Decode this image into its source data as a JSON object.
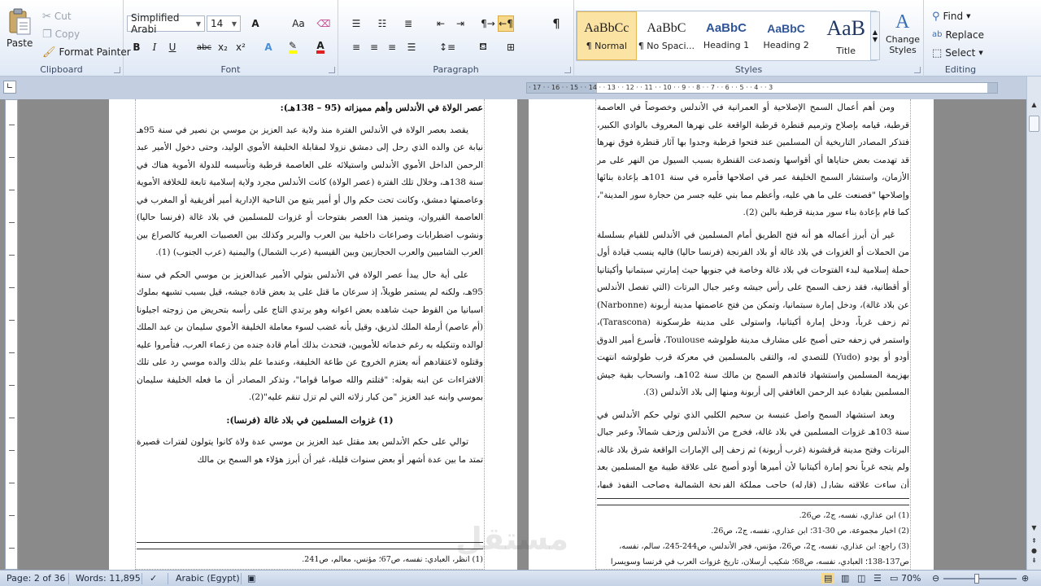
{
  "clipboard": {
    "label": "Clipboard",
    "paste": "Paste",
    "cut": "Cut",
    "copy": "Copy",
    "format_painter": "Format Painter"
  },
  "font": {
    "label": "Font",
    "family": "Simplified Arabi",
    "size": "14",
    "bold": "B",
    "italic": "I",
    "underline": "U",
    "strike": "abc",
    "subscript": "x₂",
    "superscript": "x²",
    "grow": "A",
    "case": "Aa",
    "highlight_color": "#ffff00",
    "font_color": "#e02020"
  },
  "paragraph": {
    "label": "Paragraph",
    "show_marks": "¶"
  },
  "styles": {
    "label": "Styles",
    "items": [
      {
        "sample": "AaBbCc",
        "name": "¶ Normal"
      },
      {
        "sample": "AaBbC",
        "name": "¶ No Spaci..."
      },
      {
        "sample": "AaBbC",
        "name": "Heading 1"
      },
      {
        "sample": "AaBbC",
        "name": "Heading 2"
      },
      {
        "sample": "AaB",
        "name": "Title"
      }
    ],
    "change": "Change Styles"
  },
  "editing": {
    "label": "Editing",
    "find": "Find",
    "replace": "Replace",
    "select": "Select"
  },
  "ruler": {
    "numbers": "· 17 · · 16 · · 15 · · 14 · · 13 · · 12 · · 11 · · 10 · · 9 · · 8 · · 7 · · 6 · · 5 · · 4 · · 3"
  },
  "page_left": {
    "heading": "عصر الولاة في الأندلس وأهم مميزاته (95 – 138هـ):",
    "paragraphs": [
      "يقصد بعصر الولاة في الأندلس الفترة منذ ولاية عبد العزيز بن موسي بن نصير في سنة 95هـ نيابة عن والده الذي رحل إلى دمشق نزولا لمقابلة الخليفة الأموي الوليد، وحتى دخول الأمير عبد الرحمن الداخل الأموي الأندلس واستيلائه على العاصمة قرطبة وتأسيسه للدولة الأموية هناك في سنة 138هـ، وخلال تلك الفترة (عصر الولاة) كانت الأندلس مجرد ولاية إسلامية تابعة للخلافة الأموية وعاصمتها دمشق، وكانت تحت حكم وال أو أمير يتبع من الناحية الإدارية أمير أفريقية أو المغرب في العاصمة القيروان، ويتميز هذا العصر بفتوحات أو غزوات للمسلمين في بلاد غالة (فرنسا حاليا) ونشوب اضطرابات وصراعات داخلية بين العرب والبربر وكذلك بين العصبيات العربية كالصراع بين العرب الشاميين والعرب الحجازيين وبين القيسية (عرب الشمال) واليمنية (عرب الجنوب) (1).",
      "على أية حال يبدأ عصر الولاة في الأندلس بتولي الأمير عبدالعزيز بن موسي الحكم في سنة 95هـ، ولكنه لم يستمر طويلاً، إذ سرعان ما قتل على يد بعض قادة جيشه، قيل بسبب تشبهه بملوك اسبانيا من القوط حيث شاهده بعض اعوانه وهو يرتدي التاج على رأسه بتحريض من زوجته اجيلونا (أم عاصم) أرملة الملك لذريق، وقيل بأنه غضب لسوء معاملة الخليفة الأموي سليمان بن عبد الملك لوالده وتنكيله به رغم خدماته للأمويين، فتحدث بذلك أمام قادة جنده من زعماء العرب، فتأمروا عليه وقتلوه لاعتقادهم أنه يعتزم الخروج عن طاعة الخليفة، وعندما علم بذلك والده موسي رد على تلك الافتراءات عن ابنه بقوله: \"قتلتم والله صواما قواما\"، وتذكر المصادر أن ما فعله الخليفة سليمان بموسي وابنه عبد العزيز \"من كبار زلاته التي لم تزل تنقم عليه\"(2)."
    ],
    "subheading": "(1) غزوات المسلمين في بلاد غالة (فرنسا):",
    "paragraph_end": "توالي على حكم الأندلس بعد مقتل عبد العزيز بن موسي عدة ولاة كانوا يتولون لفترات قصيرة تمتد ما بين عدة أشهر أو بعض سنوات قليلة، غير أن أبرز هؤلاء هو السمح بن مالك",
    "footnote": "(1) انظر، العبادي: نفسه، ص67؛ مؤنس، معالم، ص241."
  },
  "page_right": {
    "paragraphs": [
      "ومن أهم أعمال السمح الإصلاحية أو العمرانية في الأندلس وخصوصاً في العاصمة قرطبة، قيامه بإصلاح وترميم قنطرة قرطبة الواقعة على نهرها المعروف بالوادي الكبير، فتذكر المصادر التاريخية أن المسلمين عند فتحوا قرطبة وجدوا بها آثار قنطرة فوق نهرها قد تهدمت بعض حناياها أي أقواسها وتصدعت القنطرة بسبب السيول من النهر على مر الأزمان، واستشار السمح الخليفة عمر في اصلاحها فأمره في سنة 101هـ بإعادة بنائها وإصلاحها \"فصنعت على ما هي عليه، وأعظم مما بني عليه جسر من حجارة سور المدينة\"، كما قام بإعادة بناء سور مدينة قرطبة بالبن (2).",
      "غير أن أبرز أعماله هو أنه فتح الطريق أمام المسلمين في الأندلس للقيام بسلسلة من الحملات أو الغزوات في بلاد غالة أو بلاد الفرنجة (فرنسا حاليا) فاليه ينسب قيادة أول حملة إسلامية لبدء الفتوحات في بلاد غالة وخاصة في جنوبها حيث إمارتي سبتمانيا وأكيتانيا أو أقطانية، فقد زحف السمح على رأس جيشه وعبر جبال البرتات (التي تفصل الأندلس عن بلاد غالة)، ودخل إمارة سبتمانيا، وتمكن من فتح عاصمتها مدينة أربونة (Narbonne) ثم زحف غرباً، ودخل إمارة أكيتانيا، واستولى على مدينة طرسكونة (Tarascona)، واستمر في زحفه حتى أصبح على مشارف مدينة طولوشه Toulouse، فأسرع أمير الدوق أودو أو يودو (Yudo) للتصدي له، والتقى بالمسلمين في معركة قرب طولوشه انتهت بهزيمة المسلمين واستشهاد قائدهم السمح بن مالك سنة 102هـ، وانسحاب بقية جيش المسلمين بقيادة عبد الرحمن الغافقي إلى أربونة ومنها إلى بلاد الأندلس (3).",
      "وبعد استشهاد السمح واصل عنبسة بن سحيم الكلبي الذي تولي حكم الأندلس في سنة 103هـ غزوات المسلمين في بلاد غالة، فخرج من الأندلس وزحف شمالاً، وعبر جبال البرتات وفتح مدينة قرقشونة (غرب أربونة) ثم زحف إلى الإمارات الواقعة شرق بلاد غالة، ولم يتجه غرباً نحو إمارة أكيتانيا لأن أميرها أودو أصبح على علاقة طيبة مع المسلمين بعد أن ساءت علاقته بشارل (قارله) حاجب مملكة الفرنجة الشمالية وصاحب النفوذ فيها، وقيل أن أودو كان على"
    ],
    "footnotes": [
      "(1) ابن عذاري، نفسه، ج2، ص26.",
      "(2) اخبار مجموعة، ص 30-31؛ ابن عذاري، نفسه، ج2، ص26.",
      "(3) راجع: ابن عذاري، نفسه، ج2، ص26، مؤنس، فجر الأندلس، ص244-245، سالم، نفسه، ص137-138؛ العبادي، نفسه، ص68؛ شكيب أرسلان، تاريخ غزوات العرب في فرنسا وسويسرا وإيطاليا وجزائر"
    ]
  },
  "status": {
    "page": "Page: 2 of 36",
    "words": "Words: 11,895",
    "language": "Arabic (Egypt)",
    "zoom": "70%",
    "zoom_fraction": 0.45
  },
  "watermark": "مستقل"
}
